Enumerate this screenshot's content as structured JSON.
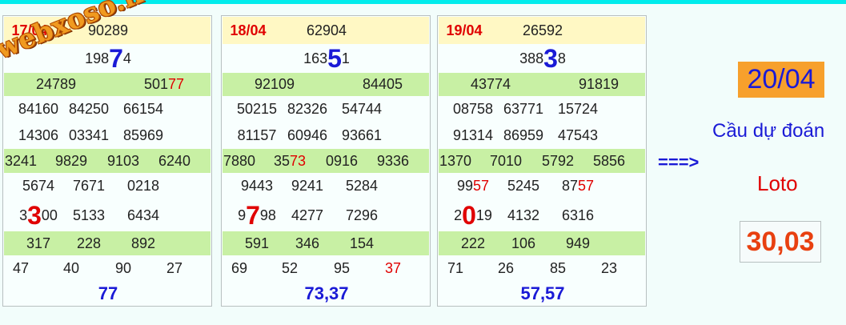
{
  "watermark": "webxoso.net",
  "arrow": "===>",
  "prediction": {
    "date": "20/04",
    "title": "Cầu dự đoán",
    "kind": "Loto",
    "numbers": "30,03"
  },
  "cards": [
    {
      "date": "17/04",
      "special": "90289",
      "r1": {
        "a": "198",
        "b": "7",
        "c": "4"
      },
      "r2": [
        {
          "t": "24789"
        },
        {
          "t": "501",
          "r": "77"
        }
      ],
      "r3": [
        "84160",
        "84250",
        "66154"
      ],
      "r4": [
        "14306",
        "03341",
        "85969"
      ],
      "r5": [
        {
          "t": "3241"
        },
        {
          "t": "9829"
        },
        {
          "t": "9103"
        },
        {
          "t": "6240"
        }
      ],
      "r6": [
        {
          "t": "5674"
        },
        {
          "t": "7671"
        },
        {
          "t": "0218"
        }
      ],
      "r7": [
        {
          "a": "3",
          "b": "3",
          "c": "00"
        },
        {
          "t": "5133"
        },
        {
          "t": "6434"
        }
      ],
      "r8": [
        "317",
        "228",
        "892"
      ],
      "r9": [
        {
          "t": "47"
        },
        {
          "t": "40"
        },
        {
          "t": "90"
        },
        {
          "t": "27"
        }
      ],
      "result": "77"
    },
    {
      "date": "18/04",
      "special": "62904",
      "r1": {
        "a": "163",
        "b": "5",
        "c": "1"
      },
      "r2": [
        {
          "t": "92109"
        },
        {
          "t": "84405"
        }
      ],
      "r3": [
        "50215",
        "82326",
        "54744"
      ],
      "r4": [
        "81157",
        "60946",
        "93661"
      ],
      "r5": [
        {
          "t": "7880"
        },
        {
          "t": "35",
          "r": "73"
        },
        {
          "t": "0916"
        },
        {
          "t": "9336"
        }
      ],
      "r6": [
        {
          "t": "9443"
        },
        {
          "t": "9241"
        },
        {
          "t": "5284"
        }
      ],
      "r7": [
        {
          "a": "9",
          "b": "7",
          "c": "98"
        },
        {
          "t": "4277"
        },
        {
          "t": "7296"
        }
      ],
      "r8": [
        "591",
        "346",
        "154"
      ],
      "r9": [
        {
          "t": "69"
        },
        {
          "t": "52"
        },
        {
          "t": "95"
        },
        {
          "r": "37"
        }
      ],
      "result": "73,37"
    },
    {
      "date": "19/04",
      "special": "26592",
      "r1": {
        "a": "388",
        "b": "3",
        "c": "8"
      },
      "r2": [
        {
          "t": "43774"
        },
        {
          "t": "91819"
        }
      ],
      "r3": [
        "08758",
        "63771",
        "15724"
      ],
      "r4": [
        "91314",
        "86959",
        "47543"
      ],
      "r5": [
        {
          "t": "1370"
        },
        {
          "t": "7010"
        },
        {
          "t": "5792"
        },
        {
          "t": "5856"
        }
      ],
      "r6": [
        {
          "t": "99",
          "r": "57"
        },
        {
          "t": "5245"
        },
        {
          "t": "87",
          "r": "57"
        }
      ],
      "r7": [
        {
          "a": "2",
          "b": "0",
          "c": "19"
        },
        {
          "t": "4132"
        },
        {
          "t": "6316"
        }
      ],
      "r8": [
        "222",
        "106",
        "949"
      ],
      "r9": [
        {
          "t": "71"
        },
        {
          "t": "26"
        },
        {
          "t": "85"
        },
        {
          "t": "23"
        }
      ],
      "result": "57,57"
    }
  ]
}
